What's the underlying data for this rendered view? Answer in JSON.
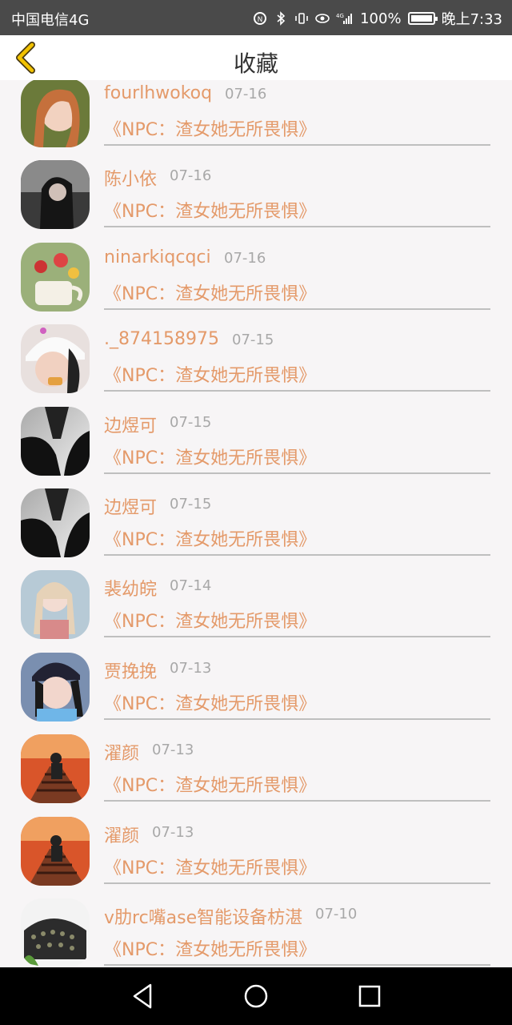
{
  "status_bar": {
    "carrier": "中国电信4G",
    "battery_percent": "100%",
    "time": "晚上7:33",
    "network_label": "4G"
  },
  "header": {
    "title": "收藏"
  },
  "favorites": [
    {
      "user": "fourlhwokoq",
      "date": "07-16",
      "book": "《NPC：渣女她无所畏惧》",
      "avatar": "avatar-girl-icon"
    },
    {
      "user": "陈小依",
      "date": "07-16",
      "book": "《NPC：渣女她无所畏惧》",
      "avatar": "avatar-girl-dark-icon"
    },
    {
      "user": "ninarkiqcqci",
      "date": "07-16",
      "book": "《NPC：渣女她无所畏惧》",
      "avatar": "avatar-flowers-icon"
    },
    {
      "user": "._874158975",
      "date": "07-15",
      "book": "《NPC：渣女她无所畏惧》",
      "avatar": "avatar-girl-hat-icon"
    },
    {
      "user": "边煜可",
      "date": "07-15",
      "book": "《NPC：渣女她无所畏惧》",
      "avatar": "avatar-man-suit-icon"
    },
    {
      "user": "边煜可",
      "date": "07-15",
      "book": "《NPC：渣女她无所畏惧》",
      "avatar": "avatar-man-suit-icon"
    },
    {
      "user": "裴幼皖",
      "date": "07-14",
      "book": "《NPC：渣女她无所畏惧》",
      "avatar": "avatar-girl-braids-icon"
    },
    {
      "user": "贾挽挽",
      "date": "07-13",
      "book": "《NPC：渣女她无所畏惧》",
      "avatar": "avatar-girl-cap-icon"
    },
    {
      "user": "濯颜",
      "date": "07-13",
      "book": "《NPC：渣女她无所畏惧》",
      "avatar": "avatar-rail-sunset-icon"
    },
    {
      "user": "濯颜",
      "date": "07-13",
      "book": "《NPC：渣女她无所畏惧》",
      "avatar": "avatar-rail-sunset-icon"
    },
    {
      "user": "v肋rc嘴ase智能设备枋湛",
      "date": "07-10",
      "book": "《NPC：渣女她无所畏惧》",
      "avatar": "avatar-machine-icon"
    }
  ],
  "colors": {
    "accent": "#e49a6a",
    "date_gray": "#a8a8a8",
    "divider": "#bfbfbf",
    "back_arrow": "#f2c200"
  },
  "nav_bar": {
    "back": "back-triangle-icon",
    "home": "home-circle-icon",
    "recents": "recents-square-icon"
  }
}
